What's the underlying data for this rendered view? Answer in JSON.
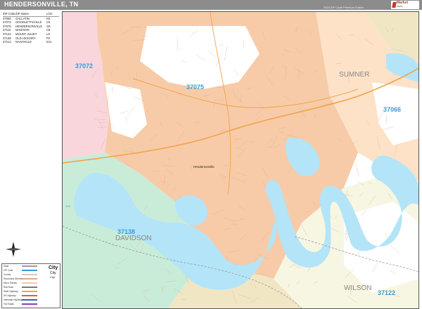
{
  "header": {
    "title": "HENDERSONVILLE, TN",
    "edition": "2023 ZIP Code Premium Edition",
    "logo_line1": "Market",
    "logo_line2": "MAPS"
  },
  "zip_table": {
    "headers": [
      "ZIP Code",
      "ZIP Name",
      "LOC"
    ],
    "rows": [
      [
        "37066",
        "GALLATIN",
        "K5"
      ],
      [
        "37072",
        "GOODLETTSVILLE",
        "C5"
      ],
      [
        "37075",
        "HENDERSONVILLE",
        "G6"
      ],
      [
        "37115",
        "MADISON",
        "C8"
      ],
      [
        "37122",
        "MOUNT JULIET",
        "L9"
      ],
      [
        "37138",
        "OLD HICKORY",
        "F8"
      ],
      [
        "37214",
        "NASHVILLE",
        "D11"
      ]
    ]
  },
  "map": {
    "zip_labels": [
      "37072",
      "37075",
      "37066",
      "37138",
      "37122"
    ],
    "county_labels": [
      "SUMNER",
      "DAVIDSON",
      "WILSON"
    ],
    "place_labels": [
      "Hendersonville"
    ],
    "road_label": "31E",
    "colors": {
      "zip_37075": "#f7cba8",
      "zip_37072": "#f9d6dc",
      "zip_37066": "#fde2c8",
      "zip_37138": "#c9ecd9",
      "zip_37122": "#f6f6e2",
      "zip_37214": "#f1e6c4",
      "water": "#b4e4f8",
      "label_blue": "#3a9bd4",
      "county_label": "#888888",
      "street": "#e3a788",
      "highway": "#f2a34a",
      "boundary": "#9a9a9a"
    }
  },
  "legend": {
    "items": [
      "State",
      "ZIP Code",
      "County",
      "Secondary Streets",
      "Minor Streets",
      "Rail Road",
      "State Highway",
      "US Highway",
      "Interstate Highway",
      "Toll Roads"
    ],
    "city_labels": [
      "City",
      "City",
      "City"
    ]
  }
}
